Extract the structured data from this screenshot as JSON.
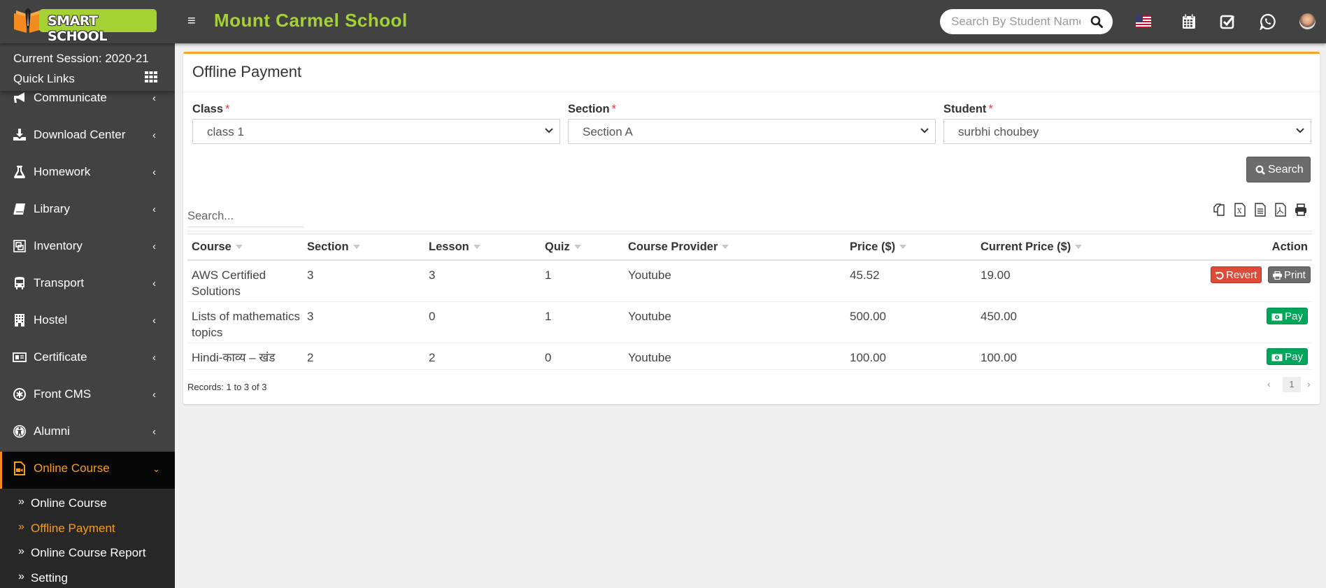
{
  "header": {
    "logo_text": "SMART SCHOOL",
    "school_name": "Mount Carmel School",
    "search_placeholder": "Search By Student Name",
    "icons": [
      "menu-icon",
      "search-icon",
      "us-flag-icon",
      "calendar-icon",
      "check-square-icon",
      "whatsapp-icon",
      "user-avatar"
    ]
  },
  "sidebar": {
    "session": "Current Session: 2020-21",
    "quick_links": "Quick Links",
    "items": [
      {
        "label": "Communicate",
        "icon": "bullhorn-icon"
      },
      {
        "label": "Download Center",
        "icon": "download-icon"
      },
      {
        "label": "Homework",
        "icon": "flask-icon"
      },
      {
        "label": "Library",
        "icon": "book-icon"
      },
      {
        "label": "Inventory",
        "icon": "object-group-icon"
      },
      {
        "label": "Transport",
        "icon": "bus-icon"
      },
      {
        "label": "Hostel",
        "icon": "building-icon"
      },
      {
        "label": "Certificate",
        "icon": "newspaper-icon"
      },
      {
        "label": "Front CMS",
        "icon": "asterisk-circle-icon"
      },
      {
        "label": "Alumni",
        "icon": "universal-access-icon"
      },
      {
        "label": "Online Course",
        "icon": "file-video-icon",
        "active": true
      }
    ],
    "submenu": [
      {
        "label": "Online Course"
      },
      {
        "label": "Offline Payment",
        "active": true
      },
      {
        "label": "Online Course Report"
      },
      {
        "label": "Setting"
      }
    ]
  },
  "page": {
    "title": "Offline Payment",
    "filters": {
      "class": {
        "label": "Class",
        "value": "class 1"
      },
      "section": {
        "label": "Section",
        "value": "Section A"
      },
      "student": {
        "label": "Student",
        "value": "surbhi choubey"
      },
      "required_mark": "*"
    },
    "search_button": "Search",
    "table_search_placeholder": "Search...",
    "export_tools": [
      "copy-icon",
      "excel-icon",
      "csv-icon",
      "pdf-icon",
      "print-icon"
    ],
    "columns": [
      "Course",
      "Section",
      "Lesson",
      "Quiz",
      "Course Provider",
      "Price ($)",
      "Current Price ($)",
      "Action"
    ],
    "rows": [
      {
        "course": "AWS Certified Solutions",
        "section": "3",
        "lesson": "3",
        "quiz": "1",
        "provider": "Youtube",
        "price": "45.52",
        "current_price": "19.00",
        "actions": [
          "Revert",
          "Print"
        ]
      },
      {
        "course": "Lists of mathematics topics",
        "section": "3",
        "lesson": "0",
        "quiz": "1",
        "provider": "Youtube",
        "price": "500.00",
        "current_price": "450.00",
        "actions": [
          "Pay"
        ]
      },
      {
        "course": "Hindi-काव्य – खंड",
        "section": "2",
        "lesson": "2",
        "quiz": "0",
        "provider": "Youtube",
        "price": "100.00",
        "current_price": "100.00",
        "actions": [
          "Pay"
        ]
      }
    ],
    "records_text": "Records: 1 to 3 of 3",
    "pagination": {
      "prev": "‹",
      "current": "1",
      "next": "›"
    }
  },
  "colors": {
    "header_bg": "#424242",
    "brand_green": "#a4d233",
    "accent_orange": "#f89c1c",
    "revert_red": "#dd4b39",
    "pay_green": "#00a65a",
    "print_gray": "#6c6c6c"
  }
}
